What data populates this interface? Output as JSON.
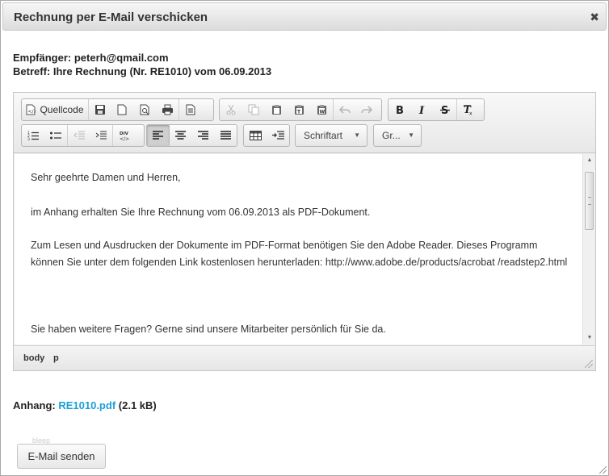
{
  "dialog": {
    "title": "Rechnung per E-Mail verschicken",
    "close_glyph": "✖"
  },
  "meta": {
    "recipient": "Empfänger: peterh@qmail.com",
    "subject": "Betreff: Ihre Rechnung (Nr. RE1010) vom 06.09.2013"
  },
  "toolbar": {
    "source_label": "Quellcode",
    "font_label": "Schriftart",
    "size_label": "Gr...",
    "icons": [
      "source-icon",
      "save-icon",
      "new-page-icon",
      "preview-icon",
      "print-icon",
      "template-icon",
      "cut-icon",
      "copy-icon",
      "paste-icon",
      "paste-text-icon",
      "paste-word-icon",
      "undo-icon",
      "redo-icon",
      "bold-icon",
      "italic-icon",
      "strikethrough-icon",
      "remove-format-icon",
      "numbered-list-icon",
      "bulleted-list-icon",
      "outdent-icon",
      "indent-icon",
      "div-icon",
      "align-left-icon",
      "align-center-icon",
      "align-right-icon",
      "justify-icon",
      "table-icon",
      "indent-block-icon"
    ]
  },
  "content": {
    "greeting": "Sehr geehrte Damen und Herren,",
    "para1": "im Anhang erhalten Sie Ihre Rechnung vom 06.09.2013 als PDF-Dokument.",
    "para2": "Zum Lesen und Ausdrucken der Dokumente im PDF-Format benötigen Sie den Adobe Reader. Dieses Programm können Sie unter dem folgenden Link kostenlosen herunterladen: http://www.adobe.de/products/acrobat /readstep2.html",
    "para3": "Sie haben weitere Fragen? Gerne sind unsere Mitarbeiter persönlich für Sie da."
  },
  "statusbar": {
    "path": [
      "body",
      "p"
    ]
  },
  "attachment": {
    "label": "Anhang:",
    "file": "RE1010.pdf",
    "size": "(2.1 kB)"
  },
  "send_button": "E-Mail senden",
  "ghost_text": "bleep",
  "colors": {
    "link": "#1a9fd6",
    "text": "#222222"
  }
}
